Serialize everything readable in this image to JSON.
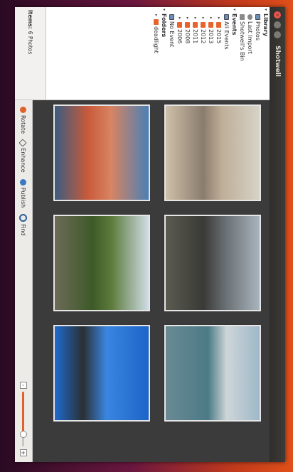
{
  "window": {
    "title": "Shotwell"
  },
  "sidebar": {
    "library_label": "Library",
    "library_items": [
      {
        "label": "Photos"
      },
      {
        "label": "Last Import"
      },
      {
        "label": "Shotwell's Bin"
      }
    ],
    "events_label": "Events",
    "event_items": [
      {
        "label": "All Events"
      },
      {
        "label": "2015"
      },
      {
        "label": "2013"
      },
      {
        "label": "2012"
      },
      {
        "label": "2011"
      },
      {
        "label": "2008"
      },
      {
        "label": "2006"
      },
      {
        "label": "No Event"
      }
    ],
    "folders_label": "Folders",
    "folder_items": [
      {
        "label": "deadlight"
      }
    ],
    "status": {
      "label": "Items:",
      "value": "6 Photos"
    }
  },
  "toolbar": {
    "rotate_label": "Rotate",
    "enhance_label": "Enhance",
    "publish_label": "Publish",
    "find_label": "Find",
    "zoom_minus": "-",
    "zoom_plus": "+",
    "zoom_level": 0.78
  },
  "colors": {
    "accent": "#e0622a",
    "viewer_bg": "#3b3b3b"
  }
}
